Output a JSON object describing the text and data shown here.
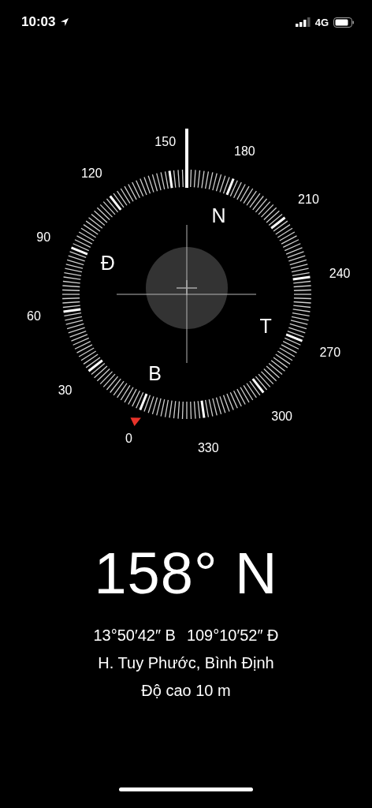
{
  "status_bar": {
    "time": "10:03",
    "network": "4G"
  },
  "compass": {
    "degree_labels": [
      "0",
      "30",
      "60",
      "90",
      "120",
      "150",
      "180",
      "210",
      "240",
      "270",
      "300",
      "330"
    ],
    "cardinal_labels": [
      "B",
      "Đ",
      "N",
      "T"
    ]
  },
  "reading": {
    "heading": "158° N",
    "coordinates": [
      "13°50′42″ B",
      "109°10′52″ Đ"
    ],
    "place": "H. Tuy Phước, Bình Định",
    "altitude": "Độ cao 10 m"
  }
}
